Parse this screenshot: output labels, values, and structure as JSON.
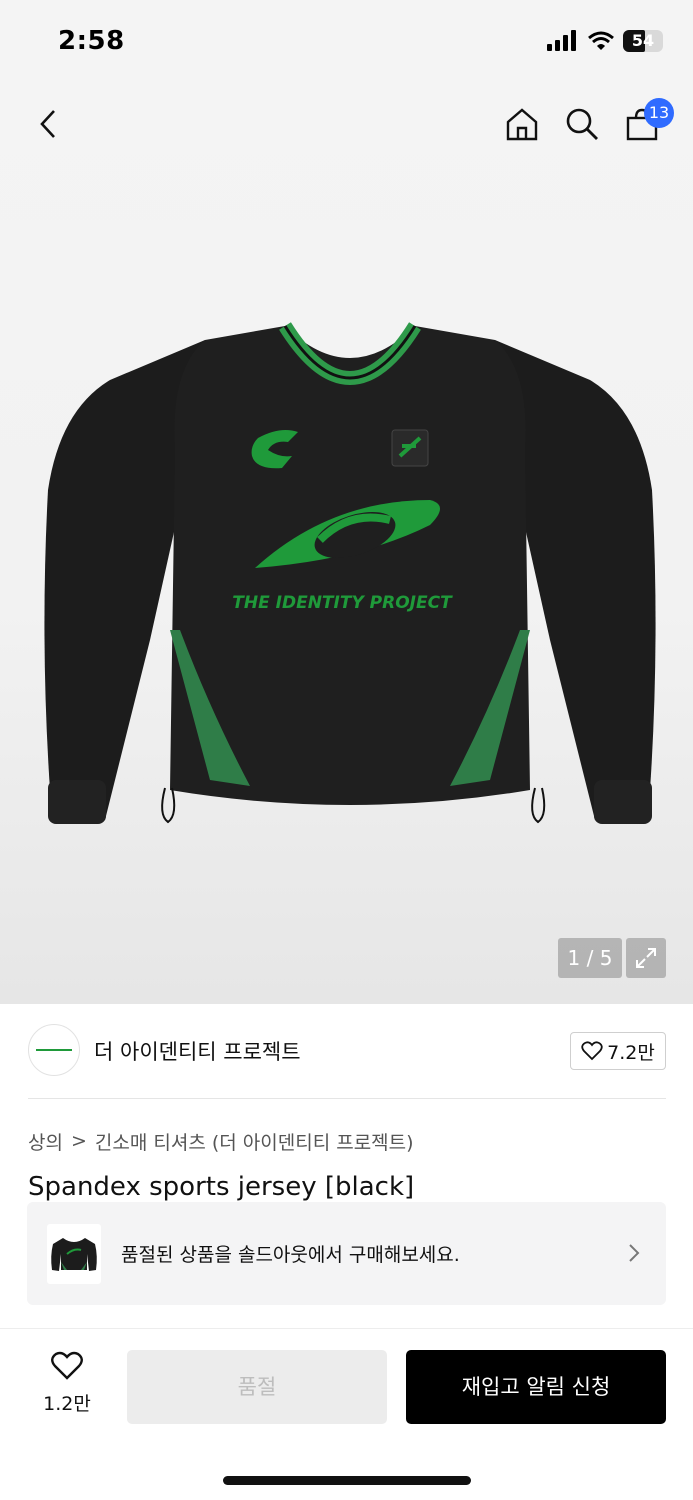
{
  "status_bar": {
    "time": "2:58",
    "battery": "54",
    "battery_level": 0.54
  },
  "nav": {
    "cart_count": "13",
    "icons": [
      "back-icon",
      "home-icon",
      "search-icon",
      "cart-icon"
    ]
  },
  "product_image": {
    "print_text": "THE IDENTITY PROJECT",
    "counter": "1 / 5",
    "colors": {
      "body": "#1c1c1c",
      "accent": "#2f7d48",
      "logo": "#1f9a3a"
    }
  },
  "brand": {
    "name": "더 아이덴티티 프로젝트",
    "likes": "7.2만"
  },
  "breadcrumb": {
    "category": "상의",
    "separator": ">",
    "subcategory": "긴소매 티셔츠 (더 아이덴티티 프로젝트)"
  },
  "product": {
    "title": "Spandex sports jersey [black]"
  },
  "soldout_notice": {
    "text": "품절된 상품을 솔드아웃에서 구매해보세요."
  },
  "bottom_bar": {
    "wish_count": "1.2만",
    "soldout_label": "품절",
    "restock_label": "재입고 알림 신청"
  }
}
